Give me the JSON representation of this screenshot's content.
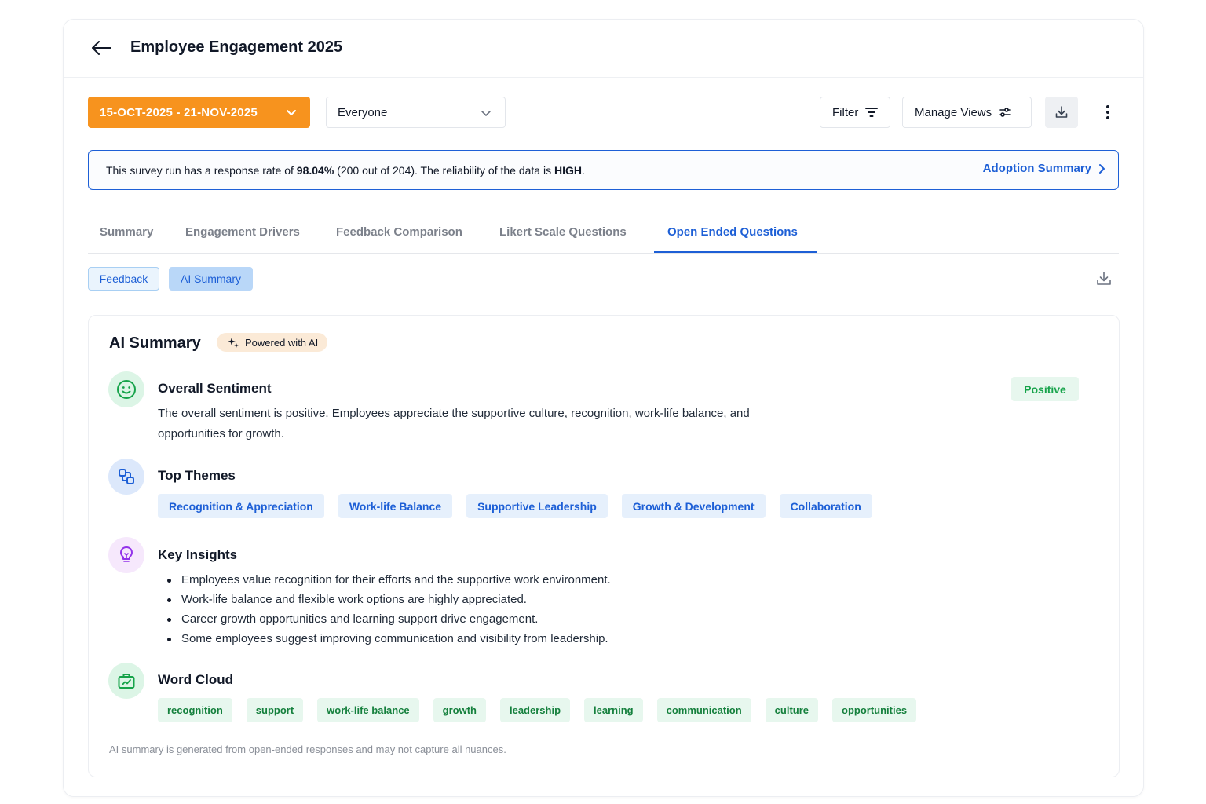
{
  "header": {
    "title": "Employee Engagement 2025"
  },
  "toolbar": {
    "date_range": "15-OCT-2025 - 21-NOV-2025",
    "audience": "Everyone",
    "filter_label": "Filter",
    "manage_views_label": "Manage Views"
  },
  "banner": {
    "text_1": "This survey run has a response rate of ",
    "rate": "98.04%",
    "text_2": " (200 out of 204). The reliability of the data is ",
    "reliability": "HIGH",
    "text_3": ".",
    "link": "Adoption Summary"
  },
  "tabs": [
    "Summary",
    "Engagement Drivers",
    "Feedback Comparison",
    "Likert Scale Questions",
    "Open Ended Questions"
  ],
  "active_tab": "Open Ended Questions",
  "view_toggle": {
    "feedback": "Feedback",
    "ai_summary": "AI Summary"
  },
  "ai_summary": {
    "title": "AI Summary",
    "powered_label": "Powered with AI",
    "sentiment": {
      "title": "Overall Sentiment",
      "badge": "Positive",
      "text": "The overall sentiment is positive. Employees appreciate the supportive culture, recognition, work-life balance, and opportunities for growth."
    },
    "themes": {
      "title": "Top Themes",
      "items": [
        "Recognition & Appreciation",
        "Work-life Balance",
        "Supportive Leadership",
        "Growth & Development",
        "Collaboration"
      ]
    },
    "insights": {
      "title": "Key Insights",
      "items": [
        "Employees value recognition for their efforts and the supportive work environment.",
        "Work-life balance and flexible work options are highly appreciated.",
        "Career growth opportunities and learning support drive engagement.",
        "Some employees suggest improving communication and visibility from leadership."
      ]
    },
    "word_cloud": {
      "title": "Word Cloud",
      "items": [
        "recognition",
        "support",
        "work-life balance",
        "growth",
        "leadership",
        "learning",
        "communication",
        "culture",
        "opportunities"
      ]
    },
    "footnote": "AI summary is generated from open-ended responses and may not capture all nuances."
  },
  "colors": {
    "brand_orange": "#f7931e",
    "accent_blue": "#1d5fd6",
    "positive_green": "#16a34a"
  },
  "icons": {
    "back": "arrow-left-icon",
    "date_chevron": "chevron-down-icon",
    "filter": "filter-lines-icon",
    "views": "sliders-icon",
    "download": "download-icon",
    "more": "vertical-dots-icon",
    "adoption": "chevron-right-icon",
    "sparkle": "sparkle-icon",
    "sentiment": "smile-icon",
    "themes": "link-shapes-icon",
    "insights": "lightbulb-icon",
    "word_cloud": "briefcase-chart-icon"
  }
}
